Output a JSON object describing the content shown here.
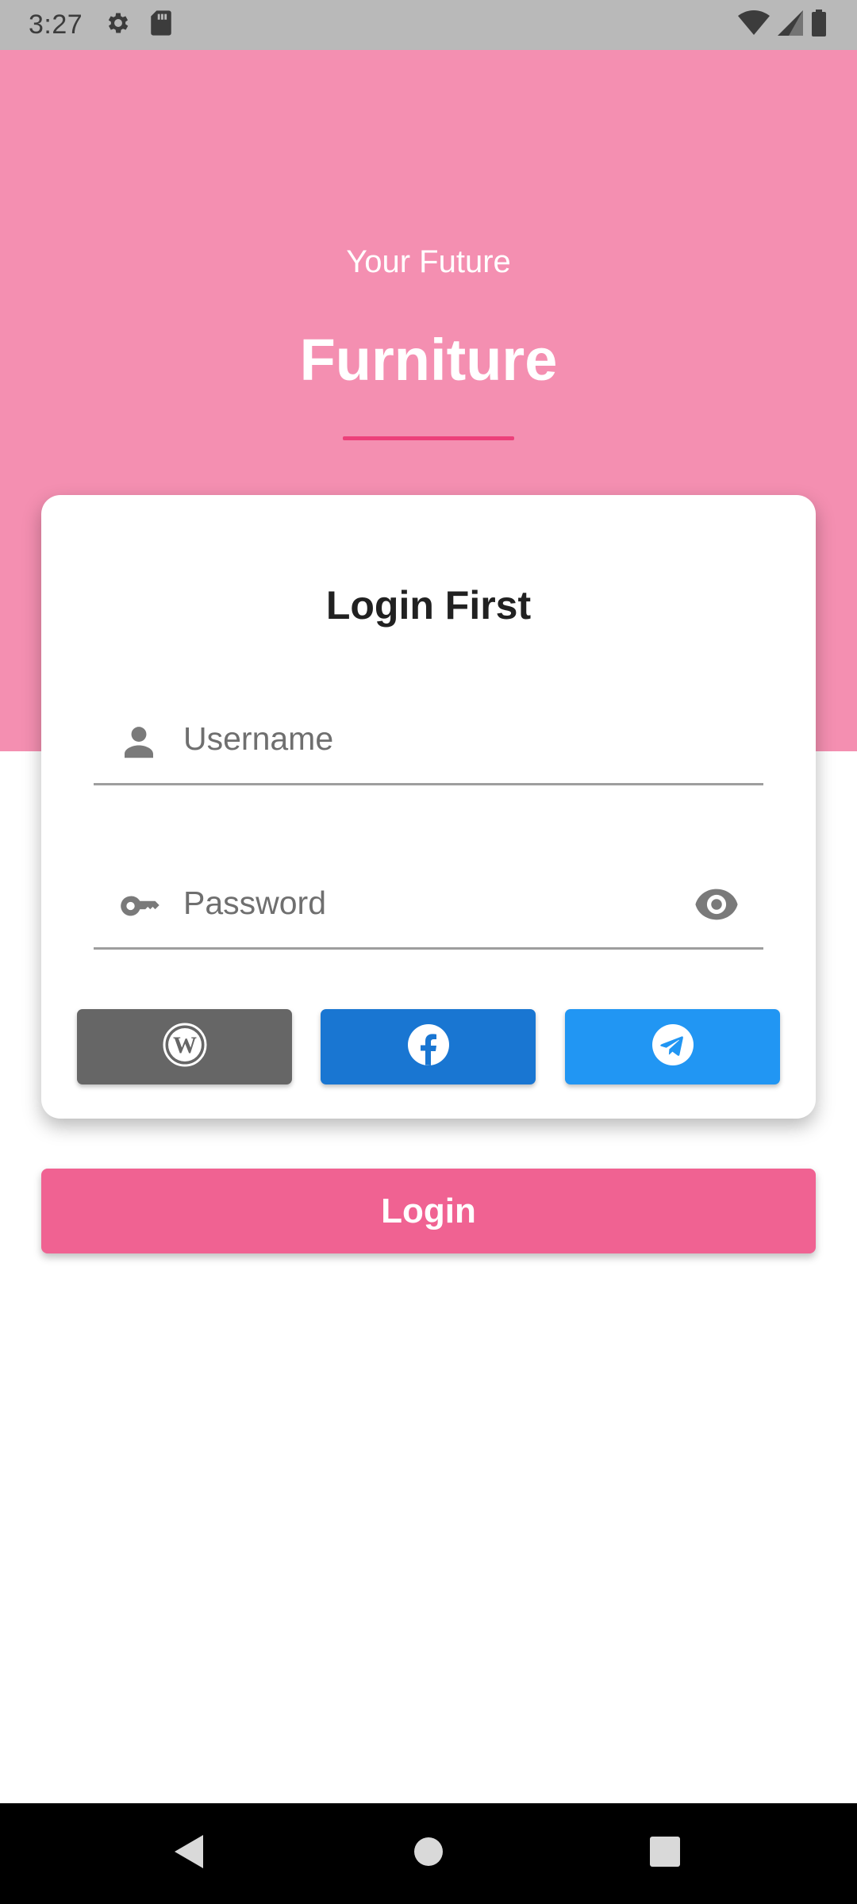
{
  "status_bar": {
    "time": "3:27",
    "icons": [
      "settings-icon",
      "sd-card-icon",
      "wifi-icon",
      "signal-icon",
      "battery-icon"
    ]
  },
  "header": {
    "subtitle": "Your Future",
    "title": "Furniture"
  },
  "login_card": {
    "title": "Login First",
    "username": {
      "placeholder": "Username",
      "value": "",
      "icon": "person-icon"
    },
    "password": {
      "placeholder": "Password",
      "value": "",
      "icon": "key-icon",
      "toggle_icon": "eye-icon"
    },
    "social_buttons": [
      {
        "name": "wordpress",
        "icon": "wordpress-icon",
        "color": "#666666"
      },
      {
        "name": "facebook",
        "icon": "facebook-icon",
        "color": "#1976d2"
      },
      {
        "name": "telegram",
        "icon": "telegram-icon",
        "color": "#2196f3"
      }
    ]
  },
  "login_button": {
    "label": "Login",
    "color": "#f06292"
  },
  "nav_bar": {
    "buttons": [
      "back-icon",
      "home-icon",
      "recents-icon"
    ]
  },
  "colors": {
    "header_background": "#f48fb1",
    "accent_divider": "#ec407a",
    "status_bar": "#b9b9b9"
  }
}
